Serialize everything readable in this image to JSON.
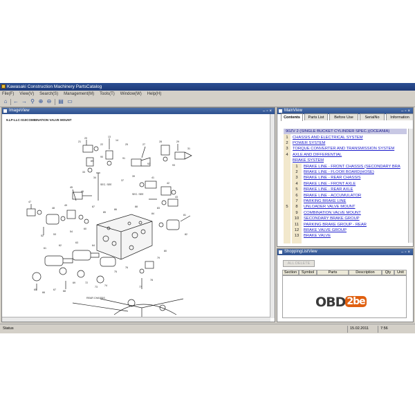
{
  "window": {
    "title": "Kawasaki Construction Machinery PartsCatalog",
    "menu": [
      "File(F)",
      "View(V)",
      "Search(S)",
      "Management(M)",
      "Tools(T)",
      "Window(W)",
      "Help(H)"
    ]
  },
  "toolbar": {
    "icons": [
      "home-icon",
      "back-icon",
      "forward-icon",
      "search-icon",
      "zoom-in-icon",
      "zoom-out-icon",
      "print-icon",
      "window-icon"
    ]
  },
  "image_view": {
    "title": "ImageView",
    "diagram_title": "9.LP-LLC-S10COMBINATION VALVE MOUNT",
    "callouts": [
      "13",
      "14",
      "20",
      "21",
      "22",
      "25",
      "27",
      "28",
      "29",
      "31",
      "33",
      "34",
      "37",
      "39",
      "41",
      "42",
      "43",
      "45",
      "46",
      "47",
      "48",
      "49",
      "52",
      "53",
      "54",
      "60",
      "61",
      "62",
      "63",
      "64",
      "65",
      "66",
      "67",
      "68",
      "69",
      "72",
      "73",
      "74",
      "75",
      "76",
      "77",
      "78",
      "79",
      "80",
      "81",
      "82",
      "83",
      "84",
      "85",
      "86",
      "87",
      "88",
      "89",
      "90",
      "91",
      "92",
      "93"
    ],
    "small_labels": [
      "SEC. SEE",
      "SEC. SEE",
      "REAR CHASSIS"
    ]
  },
  "main_view": {
    "title": "MainView",
    "tabs": [
      {
        "label": "Contents",
        "active": true
      },
      {
        "label": "Parts List",
        "active": false
      },
      {
        "label": "Before Use",
        "active": false
      },
      {
        "label": "SerialNo",
        "active": false
      },
      {
        "label": "Information",
        "active": false
      }
    ],
    "tree_header": "90ZV 2 (SINGLE BUCKET CYLINDER SPEC.)(OCEANIA)",
    "sections": [
      {
        "num": "1",
        "label": "CHASSIS AND ELECTRICAL SYSTEM"
      },
      {
        "num": "2",
        "label": "POWER SYSTEM"
      },
      {
        "num": "3",
        "label": "TORQUE CONVERTER AND TRANSMISSION SYSTEM"
      },
      {
        "num": "4",
        "label": "AXLE AND DIFFERENTIAL"
      },
      {
        "num": "",
        "label": "BRAKE SYSTEM"
      }
    ],
    "group_num": "5",
    "brake_items": [
      {
        "num": "1",
        "label": "BRAKE LINE - FRONT CHASSIS (SECONDARY BRA"
      },
      {
        "num": "2",
        "label": "BRAKE LINE - FLOOR BOARD(HOSE)"
      },
      {
        "num": "3",
        "label": "BRAKE LINE - REAR CHASSIS"
      },
      {
        "num": "4",
        "label": "BRAKE LINE - FRONT AXLE"
      },
      {
        "num": "5",
        "label": "BRAKE LINE - REAR AXLE"
      },
      {
        "num": "6",
        "label": "BRAKE LINE - ACCUMULATOR"
      },
      {
        "num": "7",
        "label": "PARKING BRAKE LINE"
      },
      {
        "num": "8",
        "label": "UNLOADER VALVE MOUNT"
      },
      {
        "num": "9",
        "label": "COMBINATION VALVE MOUNT"
      },
      {
        "num": "10",
        "label": "SECONDARY BRAKE GROUP"
      },
      {
        "num": "11",
        "label": "PARKING BRAKE GROUP - REAR"
      },
      {
        "num": "12",
        "label": "BRAKE VALVE GROUP"
      },
      {
        "num": "13",
        "label": "BRAKE VALVE"
      }
    ]
  },
  "shopping_list": {
    "title": "ShoppingListView",
    "add_button": "ALL DELETE",
    "columns": [
      "Section",
      "Symbol",
      "Parts",
      "Description",
      "Qty",
      "Unit"
    ]
  },
  "watermark": {
    "left": "OBD",
    "right": "2be"
  },
  "status": {
    "text": "Status",
    "date": "15.02.2011",
    "time": "7:56"
  },
  "colors": {
    "title_bar": "#1e3a78",
    "panel_title": "#2e5190",
    "link": "#1a1acc",
    "tree_header_bg": "#c8c8e4",
    "number_column": "#f2e8cc"
  }
}
